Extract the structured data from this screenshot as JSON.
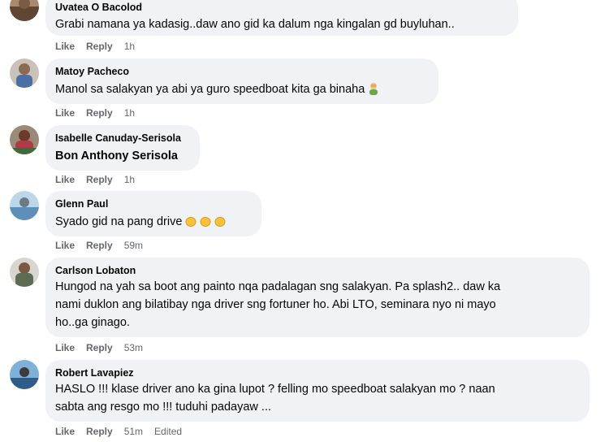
{
  "comments": [
    {
      "author": "Uvatea O Bacolod",
      "text": "Grabi namana ya kadasig..daw ano gid ka dalum nga kingalan gd buyluhan..",
      "like": "Like",
      "reply": "Reply",
      "time": "1h",
      "avatar_color": "#7b5b43"
    },
    {
      "author": "Matoy Pacheco",
      "text": "Manol sa salakyan ya abi ya guro speedboat kita ga binaha",
      "emoji": "man-facepalming-emoji",
      "like": "Like",
      "reply": "Reply",
      "time": "1h",
      "avatar_color": "#4a6fa5"
    },
    {
      "author": "Isabelle Canuday-Serisola",
      "text": "Bon Anthony Serisola",
      "like": "Like",
      "reply": "Reply",
      "time": "1h",
      "avatar_color": "#7a2b33"
    },
    {
      "author": "Glenn Paul",
      "text": "Syado gid na pang drive",
      "emoji": "clapping-hands-emoji",
      "like": "Like",
      "reply": "Reply",
      "time": "59m",
      "avatar_color": "#8fb4d6"
    },
    {
      "author": "Carlson Lobaton",
      "text_lines": [
        "Hungod na yah sa boot ang painto nqa padalagan sng salakyan. Pa splash2.. daw ka",
        "nami duklon ang bilatibay nga driver sng fortuner ho. Abi LTO, seminara nyo ni mayo",
        "ho..ga ginago."
      ],
      "like": "Like",
      "reply": "Reply",
      "time": "53m",
      "avatar_color": "#5d6b52"
    },
    {
      "author": "Robert Lavapiez",
      "text_lines": [
        "HASLO !!! klase driver ano ka gina lupot ? felling mo speedboat salakyan mo ? naan",
        "sabta ang resgo mo !!! tuduhi padayaw ..."
      ],
      "like": "Like",
      "reply": "Reply",
      "time": "51m",
      "edited": "Edited",
      "avatar_color": "#3d6f9e"
    }
  ]
}
